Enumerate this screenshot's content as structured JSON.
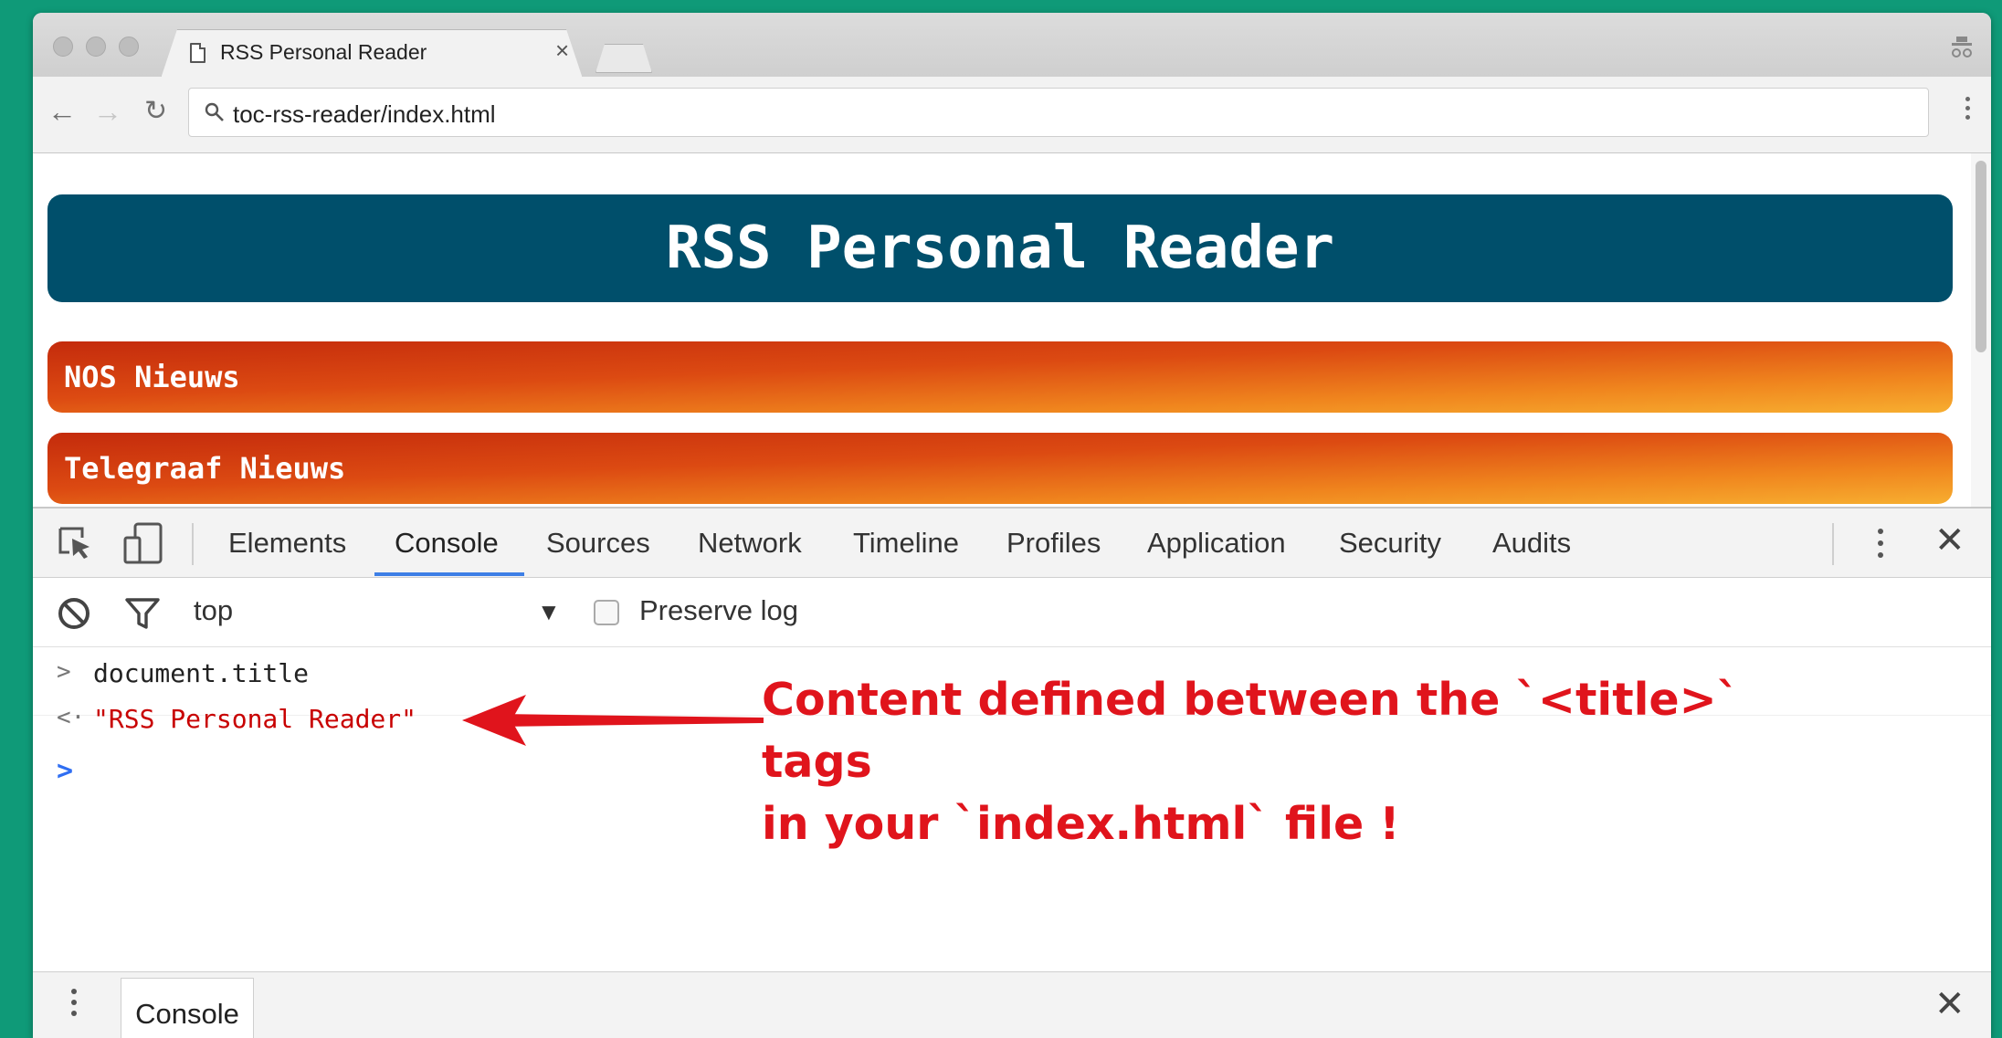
{
  "browser": {
    "tab_title": "RSS Personal Reader",
    "tab_close": "×",
    "address": "toc-rss-reader/index.html"
  },
  "page": {
    "heading": "RSS Personal Reader",
    "feeds": [
      "NOS Nieuws",
      "Telegraaf Nieuws"
    ]
  },
  "devtools": {
    "tabs": [
      "Elements",
      "Console",
      "Sources",
      "Network",
      "Timeline",
      "Profiles",
      "Application",
      "Security",
      "Audits"
    ],
    "active_tab": "Console",
    "close": "✕",
    "context": "top",
    "context_arrow": "▼",
    "preserve_log": "Preserve log",
    "console": {
      "input": "document.title",
      "output": "\"RSS Personal Reader\"",
      "input_prompt": ">",
      "output_prompt": "<·",
      "active_prompt": ">"
    },
    "annotation": {
      "line1": "Content defined between the `<title>` tags",
      "line2": "in your `index.html` file !",
      "color": "#e0141c"
    },
    "drawer_tab": "Console",
    "drawer_close": "✕"
  },
  "colors": {
    "background": "#0f9a78",
    "banner": "#004f6b",
    "feed_start": "#c42b0c",
    "feed_end": "#f7ae30",
    "active_tab_underline": "#3d7fe6"
  }
}
